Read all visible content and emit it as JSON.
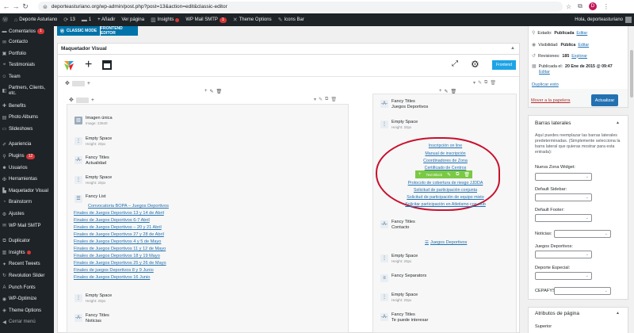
{
  "browser": {
    "url": "deporteasturiano.org/wp-admin/post.php?post=13&action=edit&classic-editor",
    "avatar_letter": "D"
  },
  "adminbar": {
    "site": "Deporte Asturiano",
    "updates": "13",
    "comments": "1",
    "new": "+ Añadir",
    "view": "Ver página",
    "insights": "Insights",
    "mail": "WP Mail SMTP",
    "mail_count": "1",
    "theme_options": "Theme Options",
    "icons_bar": "Icons Bar",
    "howdy": "Hola, deporteasturiano"
  },
  "sidebar": {
    "items": [
      {
        "label": "Comentarios",
        "badge": "1"
      },
      {
        "label": "Contacto"
      },
      {
        "label": "Portfolio"
      },
      {
        "label": "Testimonials"
      },
      {
        "label": "Team"
      },
      {
        "label": "Partners, Clients, etc."
      },
      {
        "label": "Benefits"
      },
      {
        "label": "Photo Albums"
      },
      {
        "label": "Slideshows"
      },
      {
        "label": "Apariencia"
      },
      {
        "label": "Plugins",
        "badge": "12"
      },
      {
        "label": "Usuarios"
      },
      {
        "label": "Herramientas"
      },
      {
        "label": "Maquetador Visual"
      },
      {
        "label": "Brainstorm"
      },
      {
        "label": "Ajustes"
      },
      {
        "label": "WP Mail SMTP"
      },
      {
        "label": "Duplicator"
      },
      {
        "label": "Insights"
      },
      {
        "label": "Recent Tweets"
      },
      {
        "label": "Revolution Slider"
      },
      {
        "label": "Punch Fonts"
      },
      {
        "label": "WP-Optimize"
      },
      {
        "label": "Theme Options"
      },
      {
        "label": "Cerrar menú"
      }
    ]
  },
  "editor": {
    "classic_mode": "CLASSIC MODE",
    "frontend_editor": "FRONTEND EDITOR",
    "builder_title": "Maquetador Visual",
    "frontend_button": "Frontend"
  },
  "left_col": {
    "single_image": {
      "title": "Imagen única",
      "sub": "Image: 23940"
    },
    "empty1": {
      "title": "Empty Space",
      "sub": "Height: 20px"
    },
    "fancy1": {
      "title": "Fancy Titles",
      "sub": "Actualidad"
    },
    "empty2": {
      "title": "Empty Space",
      "sub": "Height: 20px"
    },
    "fancy_list": {
      "title": "Fancy List"
    },
    "links": [
      "Convocatoria BOPA – Juegos Deportivos",
      "Finales de Juegos Deportivos 13 y 14 de Abril",
      "Finales de Juegos Deportivos 6-7 Abril",
      "Finales de Juegos Deportivos – 20 y 21 Abril",
      "Finales de Juegos Deportivos 27 y 28 de Abril",
      "Finales de Juegos Deportivos 4 y 5 de Mayo",
      "Finales de Juegos Deportivos 11 y 12 de Mayo",
      "Finales de Juegos Deportivos 18 y 19 Mayo",
      "Finales de Juegos Deportivos 25 y 26 de Mayo",
      "Finales de juegos Deportivos 8 y 9 Junio",
      "Finales de Juegos Deportivos 16 Junio"
    ],
    "empty3": {
      "title": "Empty Space",
      "sub": "Height: 20px"
    },
    "fancy2": {
      "title": "Fancy Titles",
      "sub": "Noticias"
    }
  },
  "right_col": {
    "fancy1": {
      "title": "Fancy Titles",
      "sub": "Juegos Deportivos"
    },
    "empty1": {
      "title": "Empty Space",
      "sub": "Height: 20px"
    },
    "links": [
      "Inscripción on line",
      "Manual de inscripción",
      "Coordinadores de Zona",
      "Certificado de Centros",
      "Protocolo de cobertura de riesgo JJDDA",
      "Solicitud de participación conjunta",
      "Solicitud de participación de equipo mixto",
      "Solicitar participación en Atletismo con club"
    ],
    "text_block_label": "Text Block",
    "fancy2": {
      "title": "Fancy Titles",
      "sub": "Contacto"
    },
    "juegos_link": "Juegos Deportivos",
    "empty2": {
      "title": "Empty Space",
      "sub": "Height: 20px"
    },
    "separators": {
      "title": "Fancy Separators"
    },
    "empty3": {
      "title": "Empty Space",
      "sub": "Height: 20px"
    },
    "fancy3": {
      "title": "Fancy Titles",
      "sub": "Te puede interesar"
    }
  },
  "publish": {
    "status_label": "Estado:",
    "status_value": "Publicada",
    "status_edit": "Editar",
    "visibility_label": "Visibilidad:",
    "visibility_value": "Pública",
    "visibility_edit": "Editar",
    "revisions_label": "Revisiones:",
    "revisions_value": "185",
    "revisions_link": "Explorar",
    "published_label": "Publicada el:",
    "published_value": "20 Ene de 2015 @ 09:47",
    "published_edit": "Editar",
    "duplicate": "Duplicar esto",
    "trash": "Mover a la papelera",
    "update": "Actualizar"
  },
  "sidebars_box": {
    "title": "Barras laterales",
    "desc": "Aquí puedes reemplazar las barras laterales predeterminadas. (Simplemente selecciona la barra lateral que quieras mostrar para esta entrada):",
    "fields": [
      "Nueva Zona Widget:",
      "Default Sidebar:",
      "Default Footer:",
      "Noticias:",
      "Juegos Deportivos:",
      "Deporte Especial:",
      "CEPAFYS:"
    ]
  },
  "attributes_box": {
    "title": "Atributos de página",
    "field": "Superior"
  },
  "colors": {
    "accent": "#2271b1",
    "admin_dark": "#1d2327",
    "frontend": "#1ea4e6",
    "highlight": "#c8102e",
    "element_toolbar": "#7ac943"
  }
}
